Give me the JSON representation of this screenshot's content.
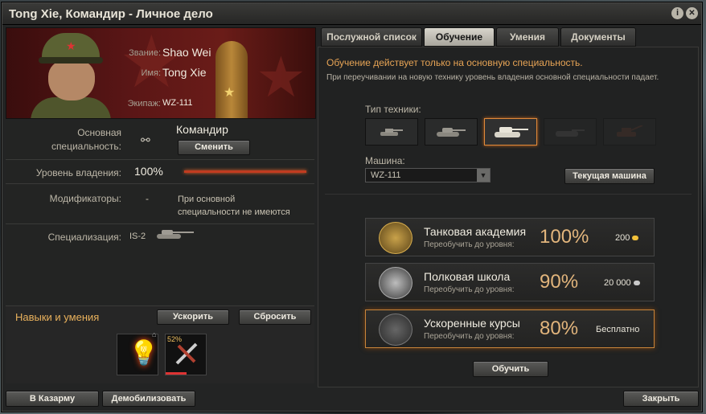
{
  "window": {
    "title": "Tong Xie, Командир - Личное дело",
    "info_icon": "i",
    "close_icon": "✕"
  },
  "profile": {
    "rank_label": "Звание:",
    "rank": "Shao Wei",
    "name_label": "Имя:",
    "name": "Tong Xie",
    "crew_label": "Экипаж:",
    "crew": "WZ-111"
  },
  "specialty": {
    "label": "Основная специальность:",
    "value": "Командир",
    "change_button": "Сменить"
  },
  "proficiency": {
    "label": "Уровень владения:",
    "value": "100%",
    "fraction": 1.0
  },
  "modifiers": {
    "label": "Модификаторы:",
    "value": "-",
    "note": "При основной специальности не имеются"
  },
  "specialization": {
    "label": "Специализация:",
    "value": "IS-2"
  },
  "skills": {
    "title": "Навыки и умения",
    "accelerate_button": "Ускорить",
    "reset_button": "Сбросить",
    "items": [
      {
        "icon": "lightbulb-icon",
        "badge": ""
      },
      {
        "icon": "repair-tools-icon",
        "badge": "52%",
        "progress": 0.52
      }
    ]
  },
  "tabs": [
    {
      "label": "Послужной список",
      "active": false
    },
    {
      "label": "Обучение",
      "active": true
    },
    {
      "label": "Умения",
      "active": false
    },
    {
      "label": "Документы",
      "active": false
    }
  ],
  "training": {
    "notice": "Обучение действует только на основную специальность.",
    "subnotice": "При переучивании на новую технику уровень владения основной специальности падает.",
    "vehicle_type_label": "Тип техники:",
    "vehicle_types": [
      {
        "icon": "light-tank-icon",
        "selected": false,
        "enabled": true
      },
      {
        "icon": "medium-tank-icon",
        "selected": false,
        "enabled": true
      },
      {
        "icon": "heavy-tank-icon",
        "selected": true,
        "enabled": true
      },
      {
        "icon": "tank-destroyer-icon",
        "selected": false,
        "enabled": false
      },
      {
        "icon": "spg-icon",
        "selected": false,
        "enabled": false
      }
    ],
    "vehicle_label": "Машина:",
    "vehicle_value": "WZ-111",
    "current_vehicle_button": "Текущая машина",
    "courses": [
      {
        "title": "Танковая академия",
        "sub": "Переобучить до уровня:",
        "pct": "100%",
        "price": "200",
        "currency": "gold",
        "selected": false
      },
      {
        "title": "Полковая школа",
        "sub": "Переобучить до уровня:",
        "pct": "90%",
        "price": "20 000",
        "currency": "credits",
        "selected": false
      },
      {
        "title": "Ускоренные курсы",
        "sub": "Переобучить до уровня:",
        "pct": "80%",
        "price": "Бесплатно",
        "currency": "",
        "selected": true
      }
    ],
    "train_button": "Обучить"
  },
  "footer": {
    "barracks_button": "В Казарму",
    "demobilize_button": "Демобилизовать",
    "close_button": "Закрыть"
  },
  "colors": {
    "accent_orange": "#e7a455",
    "gold": "#f2c13a",
    "credits": "#c9c9c9",
    "progress_red": "#c13c20"
  }
}
